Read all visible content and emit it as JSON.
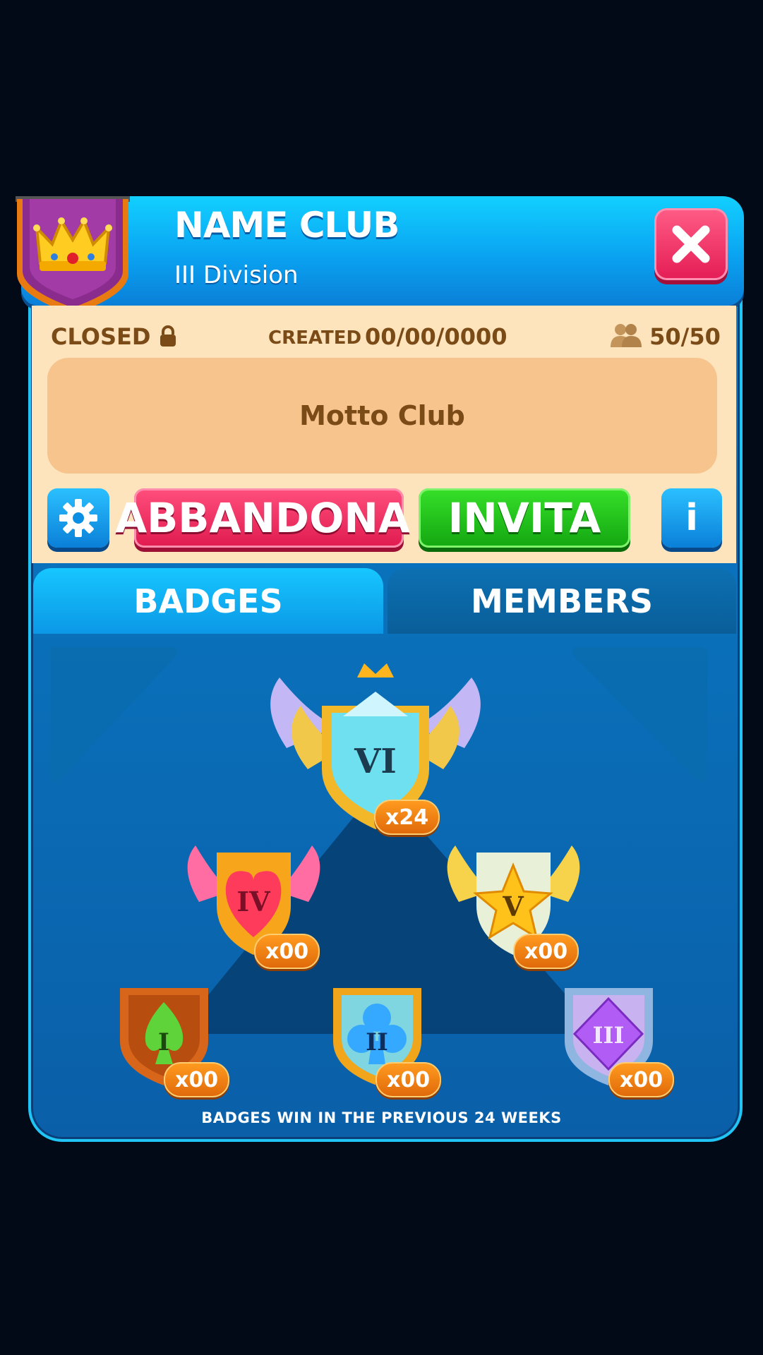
{
  "club": {
    "name": "NAME CLUB",
    "division": "III Division"
  },
  "status": {
    "label": "CLOSED",
    "created_label": "CREATED",
    "created_date": "00/00/0000",
    "members_count": "50/50"
  },
  "motto": "Motto Club",
  "buttons": {
    "leave": "ABBANDONA",
    "invite": "INVITA",
    "info": "i"
  },
  "tabs": {
    "badges": "BADGES",
    "members": "MEMBERS",
    "active": "BADGES"
  },
  "badges": [
    {
      "roman": "VI",
      "count": "x24",
      "color": "#6fe0f0"
    },
    {
      "roman": "IV",
      "count": "x00",
      "color": "#ff3b5c"
    },
    {
      "roman": "V",
      "count": "x00",
      "color": "#ffc21a"
    },
    {
      "roman": "I",
      "count": "x00",
      "color": "#5ed43a"
    },
    {
      "roman": "II",
      "count": "x00",
      "color": "#35a8ff"
    },
    {
      "roman": "III",
      "count": "x00",
      "color": "#b15cf5"
    }
  ],
  "footer": "BADGES WIN IN THE PREVIOUS 24 WEEKS",
  "icons": [
    "crown-icon",
    "close-icon",
    "lock-icon",
    "members-icon",
    "gear-icon",
    "exit-icon",
    "info-icon"
  ]
}
